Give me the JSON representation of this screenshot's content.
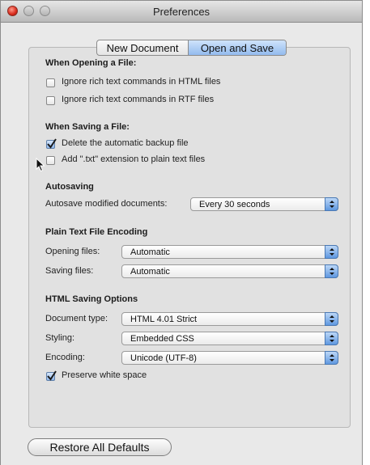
{
  "window": {
    "title": "Preferences"
  },
  "tabs": [
    {
      "label": "New Document",
      "selected": false
    },
    {
      "label": "Open and Save",
      "selected": true
    }
  ],
  "opening": {
    "heading": "When Opening a File:",
    "options": [
      {
        "label": "Ignore rich text commands in HTML files",
        "checked": false
      },
      {
        "label": "Ignore rich text commands in RTF files",
        "checked": false
      }
    ]
  },
  "saving": {
    "heading": "When Saving a File:",
    "options": [
      {
        "label": "Delete the automatic backup file",
        "checked": true
      },
      {
        "label": "Add \".txt\" extension to plain text files",
        "checked": false
      }
    ]
  },
  "autosaving": {
    "heading": "Autosaving",
    "label": "Autosave modified documents:",
    "value": "Every 30 seconds"
  },
  "encoding": {
    "heading": "Plain Text File Encoding",
    "opening_label": "Opening files:",
    "opening_value": "Automatic",
    "saving_label": "Saving files:",
    "saving_value": "Automatic"
  },
  "html": {
    "heading": "HTML Saving Options",
    "doctype_label": "Document type:",
    "doctype_value": "HTML 4.01 Strict",
    "styling_label": "Styling:",
    "styling_value": "Embedded CSS",
    "encoding_label": "Encoding:",
    "encoding_value": "Unicode (UTF-8)",
    "whitespace_label": "Preserve white space",
    "whitespace_checked": true
  },
  "footer": {
    "restore_label": "Restore All Defaults"
  },
  "colors": {
    "accent": "#93bbee",
    "stepper": "#5f98e0",
    "close": "#d8291b"
  }
}
